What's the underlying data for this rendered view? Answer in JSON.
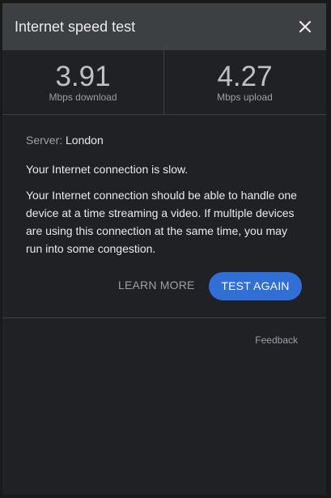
{
  "dialog": {
    "title": "Internet speed test",
    "close_icon": "close-icon"
  },
  "metrics": {
    "download": {
      "value": "3.91",
      "unit": "Mbps download"
    },
    "upload": {
      "value": "4.27",
      "unit": "Mbps upload"
    }
  },
  "result": {
    "server_label": "Server:",
    "server_value": "London",
    "status": "Your Internet connection is slow.",
    "description": "Your Internet connection should be able to handle one device at a time streaming a video. If multiple devices are using this connection at the same time, you may run into some congestion."
  },
  "actions": {
    "learn_more": "LEARN MORE",
    "test_again": "TEST AGAIN"
  },
  "footer": {
    "feedback": "Feedback"
  },
  "colors": {
    "background": "#202124",
    "header": "#3c4043",
    "accent": "#2f6fd6"
  }
}
